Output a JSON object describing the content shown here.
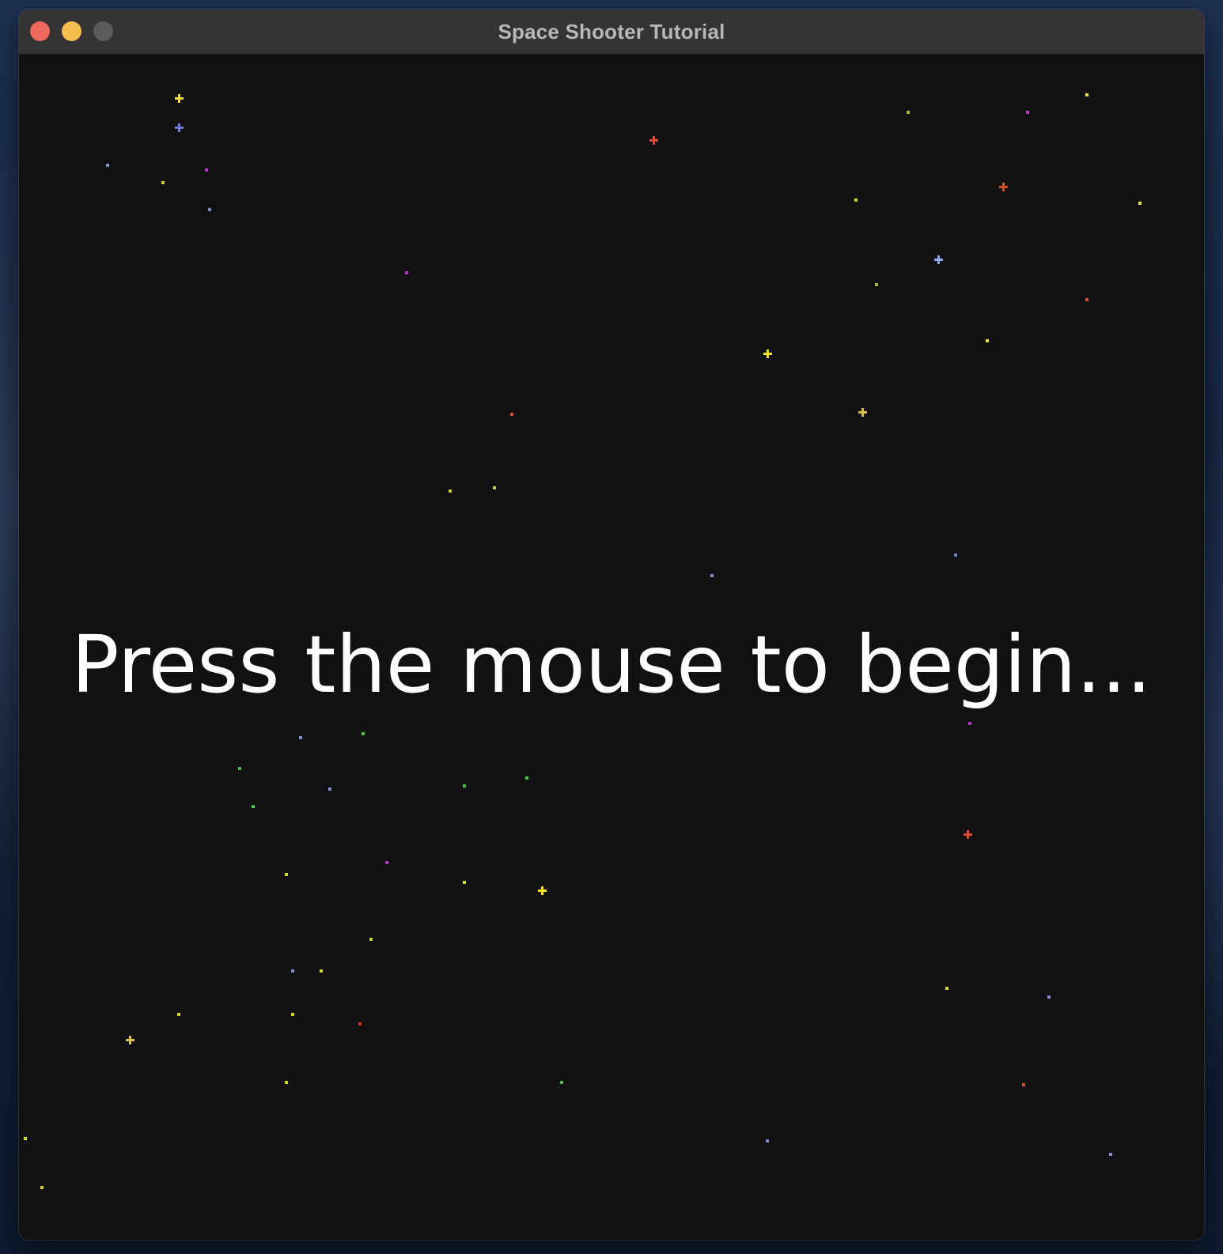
{
  "window": {
    "title": "Space Shooter Tutorial"
  },
  "game": {
    "prompt": "Press the mouse to begin..."
  },
  "colors": {
    "background": "#121112",
    "titlebar": "#353336",
    "close": "#ee6a5f",
    "minimize": "#f5bd4f",
    "maximize": "#5b5a5c"
  }
}
